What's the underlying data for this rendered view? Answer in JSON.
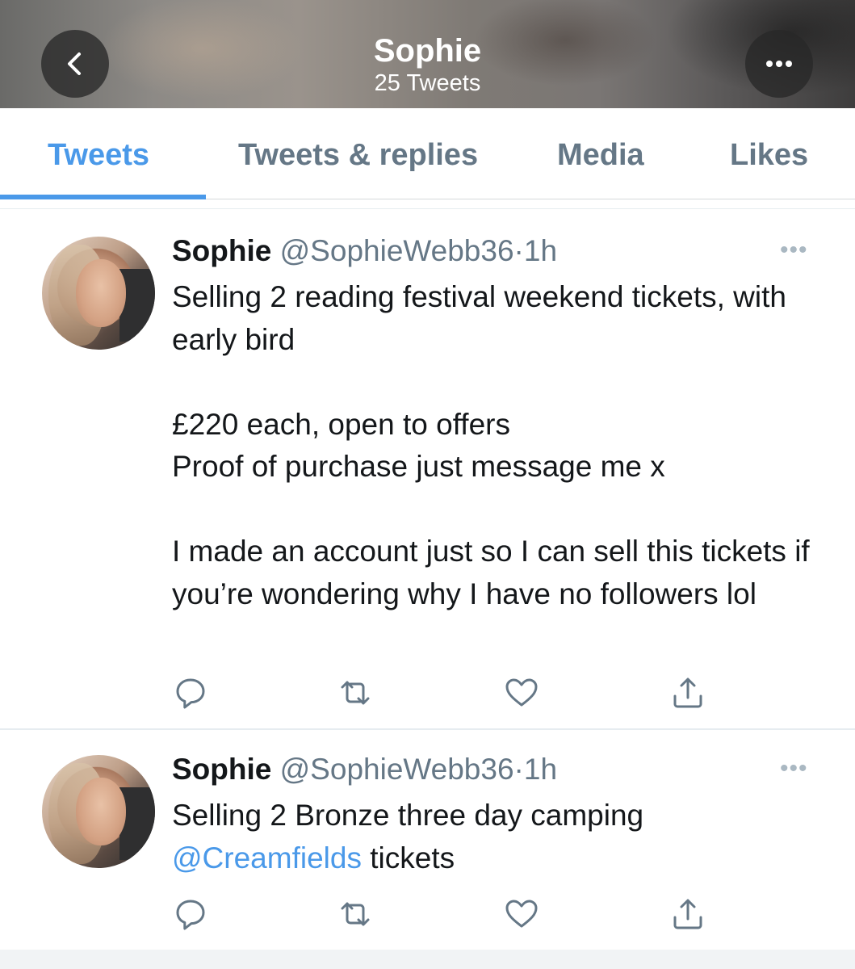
{
  "header": {
    "title": "Sophie",
    "subtitle": "25 Tweets",
    "back_icon": "chevron-left-icon",
    "more_icon": "ellipsis-icon"
  },
  "tabs": [
    {
      "label": "Tweets",
      "active": true
    },
    {
      "label": "Tweets & replies",
      "active": false
    },
    {
      "label": "Media",
      "active": false
    },
    {
      "label": "Likes",
      "active": false
    }
  ],
  "accent_color": "#4a99e9",
  "tweets": [
    {
      "name": "Sophie",
      "handle": "@SophieWebb36",
      "time": "1h",
      "separator": "·",
      "text": "Selling 2 reading festival weekend tickets, with early bird\n\n£220 each, open to offers\nProof of purchase just message me x\n\nI made an account just so I can sell this tickets if you’re wondering why I have no followers lol"
    },
    {
      "name": "Sophie",
      "handle": "@SophieWebb36",
      "time": "1h",
      "separator": "·",
      "text_before": "Selling 2 Bronze three day camping",
      "mention": "@Creamfields",
      "text_after": "tickets"
    }
  ],
  "action_icons": [
    "reply-icon",
    "retweet-icon",
    "like-icon",
    "share-icon"
  ],
  "caret_glyph": "•••",
  "back_glyph": "‹",
  "more_glyph": "•••"
}
